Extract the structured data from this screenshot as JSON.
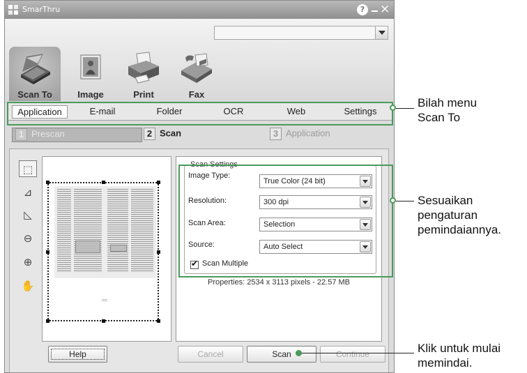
{
  "window": {
    "title": "SmarThru",
    "help_glyph": "?",
    "close_glyph": "×"
  },
  "modules": [
    {
      "label": "Scan To",
      "icon": "scanner-icon"
    },
    {
      "label": "Image",
      "icon": "image-icon"
    },
    {
      "label": "Print",
      "icon": "printer-icon"
    },
    {
      "label": "Fax",
      "icon": "fax-icon"
    }
  ],
  "menu": [
    "Application",
    "E-mail",
    "Folder",
    "OCR",
    "Web",
    "Settings"
  ],
  "steps": [
    {
      "num": "1",
      "label": "Prescan"
    },
    {
      "num": "2",
      "label": "Scan"
    },
    {
      "num": "3",
      "label": "Application"
    }
  ],
  "scan_settings": {
    "legend": "Scan Settings",
    "image_type_label": "Image Type:",
    "image_type_value": "True Color (24 bit)",
    "resolution_label": "Resolution:",
    "resolution_value": "300 dpi",
    "scan_area_label": "Scan Area:",
    "scan_area_value": "Selection",
    "source_label": "Source:",
    "source_value": "Auto Select",
    "scan_multiple_label": "Scan Multiple",
    "scan_multiple_checked": true
  },
  "properties": "Properties: 2534 x 3113 pixels - 22.57 MB",
  "buttons": {
    "help": "Help",
    "cancel": "Cancel",
    "scan": "Scan",
    "continue": "Continue"
  },
  "annotations": {
    "menu_bar_line1": "Bilah menu",
    "menu_bar_line2": "Scan To",
    "settings_line1": "Sesuaikan",
    "settings_line2": "pengaturan",
    "settings_line3": "pemindaiannya.",
    "scan_line1": "Klik untuk mulai",
    "scan_line2": "memindai."
  },
  "colors": {
    "callout": "#4a9a5a"
  }
}
